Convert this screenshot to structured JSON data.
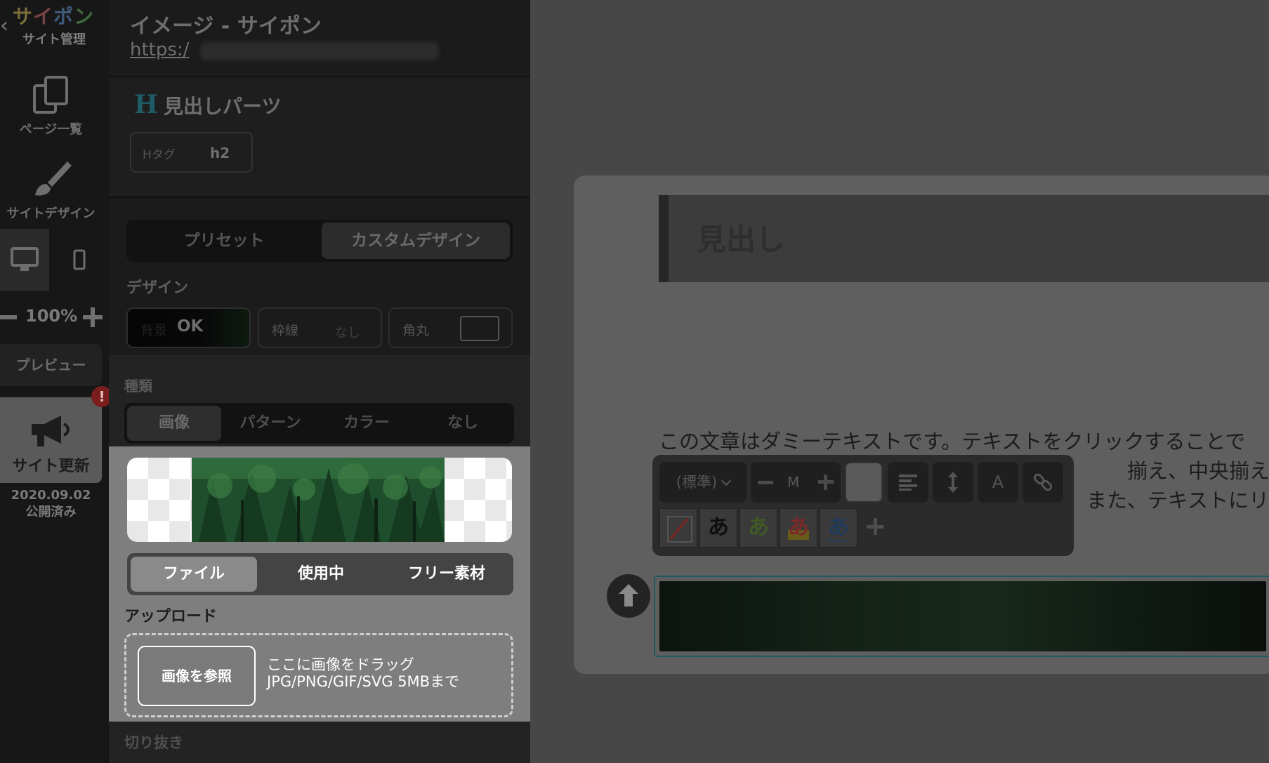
{
  "sidebar": {
    "logo": [
      "サ",
      "イ",
      "ポ",
      "ン"
    ],
    "logo_sub": "サイト管理",
    "pages_label": "ページ一覧",
    "design_label": "サイトデザイン",
    "zoom": "100%",
    "preview_label": "プレビュー",
    "update_label": "サイト更新",
    "alert": "!",
    "publish_date": "2020.09.02",
    "publish_status": "公開済み"
  },
  "panel": {
    "title": "イメージ - サイポン",
    "url": "https:/",
    "part_icon": "H",
    "part_title": "見出しパーツ",
    "htag_label": "Hタグ",
    "htag_value": "h2",
    "design_tabs": [
      "プリセット",
      "カスタムデザイン"
    ],
    "design_label": "デザイン",
    "bg_label": "背景",
    "bg_value": "OK",
    "border_label": "枠線",
    "border_value": "なし",
    "radius_label": "角丸",
    "kind_label": "種類",
    "kind_tabs": [
      "画像",
      "パターン",
      "カラー",
      "なし"
    ],
    "source_tabs": [
      "ファイル",
      "使用中",
      "フリー素材"
    ],
    "upload_label": "アップロード",
    "browse_button": "画像を参照",
    "upload_hint_1": "ここに画像をドラッグ",
    "upload_hint_2": "JPG/PNG/GIF/SVG 5MBまで",
    "crop_label": "切り抜き"
  },
  "canvas": {
    "heading": "見出し",
    "body_line_1": "この文章はダミーテキストです。テキストをクリックすることで",
    "body_line_2": "　　　　　　　　　　　　　　　　　　　　　　　揃え、中央揃え、右揃",
    "body_line_3": "　　　　　　　　　　　　　　　　　　　　　また、テキストにリン"
  },
  "toolbar": {
    "style_select": "(標準)",
    "size_value": "M",
    "font_button": "A",
    "highlight_chars": [
      "あ",
      "あ",
      "あ",
      "あ"
    ]
  },
  "colors": {
    "accent_teal": "#1f5d66",
    "alert_red": "#7a1d1d"
  }
}
